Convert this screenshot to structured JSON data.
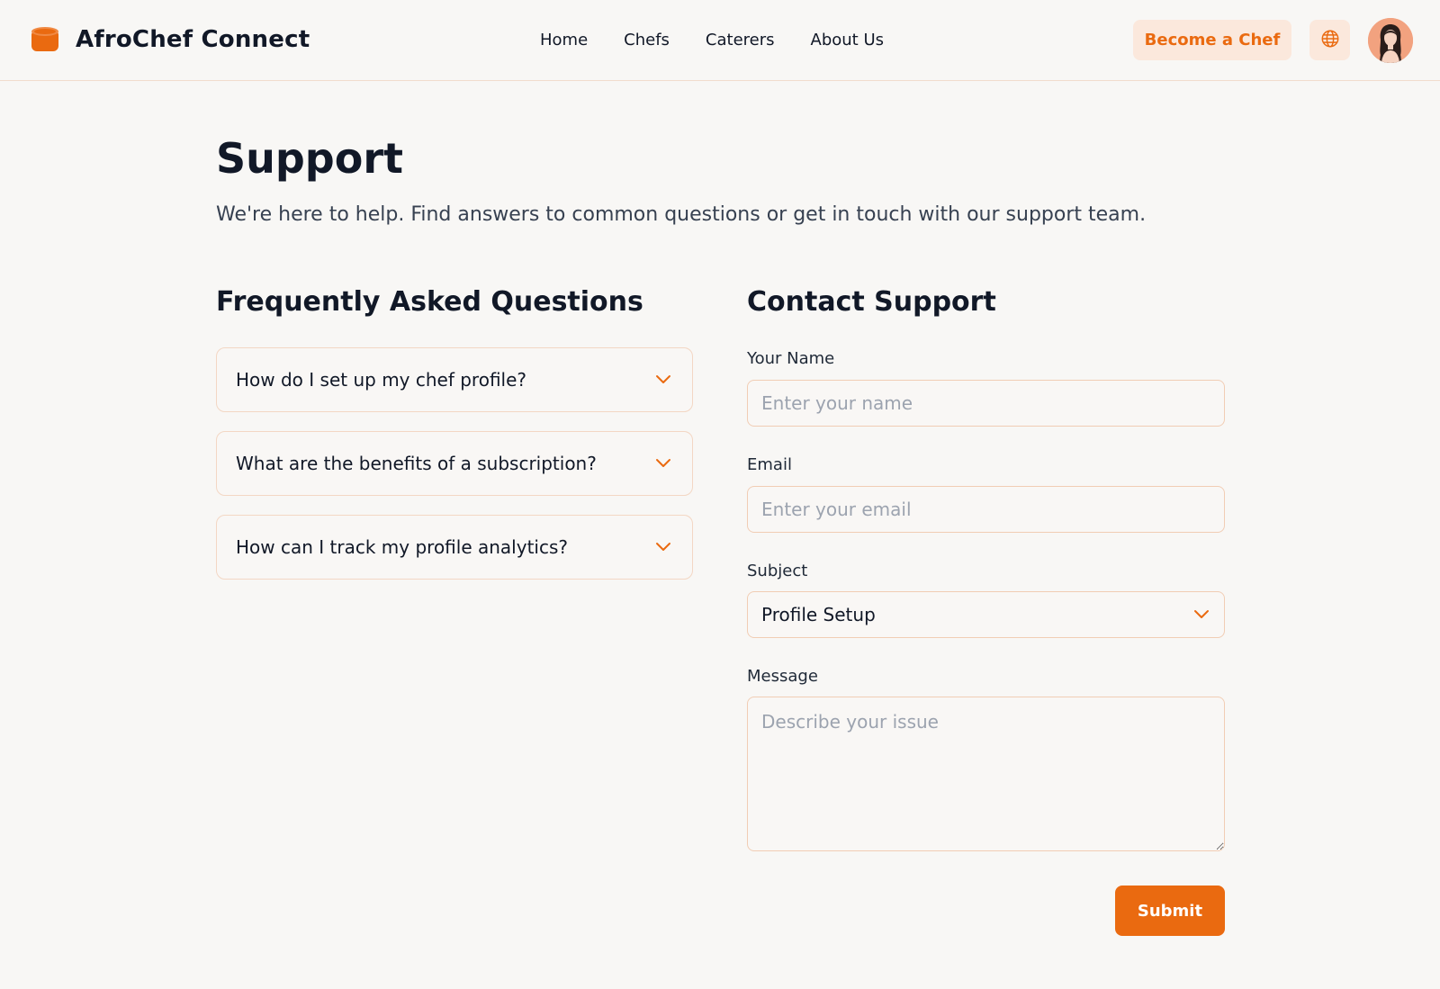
{
  "header": {
    "brand_name": "AfroChef Connect",
    "nav": [
      "Home",
      "Chefs",
      "Caterers",
      "About Us"
    ],
    "become_chef_label": "Become a Chef",
    "globe_icon": "globe-icon",
    "avatar_icon": "user-avatar"
  },
  "page": {
    "title": "Support",
    "subtitle": "We're here to help. Find answers to common questions or get in touch with our support team."
  },
  "faq": {
    "title": "Frequently Asked Questions",
    "items": [
      "How do I set up my chef profile?",
      "What are the benefits of a subscription?",
      "How can I track my profile analytics?"
    ]
  },
  "contact": {
    "title": "Contact Support",
    "name_label": "Your Name",
    "name_placeholder": "Enter your name",
    "email_label": "Email",
    "email_placeholder": "Enter your email",
    "subject_label": "Subject",
    "subject_value": "Profile Setup",
    "message_label": "Message",
    "message_placeholder": "Describe your issue",
    "submit_label": "Submit"
  },
  "colors": {
    "accent": "#ea6a10",
    "accent_soft": "#fbe8dc",
    "border": "#f1cdb4",
    "background": "#f8f7f5"
  }
}
